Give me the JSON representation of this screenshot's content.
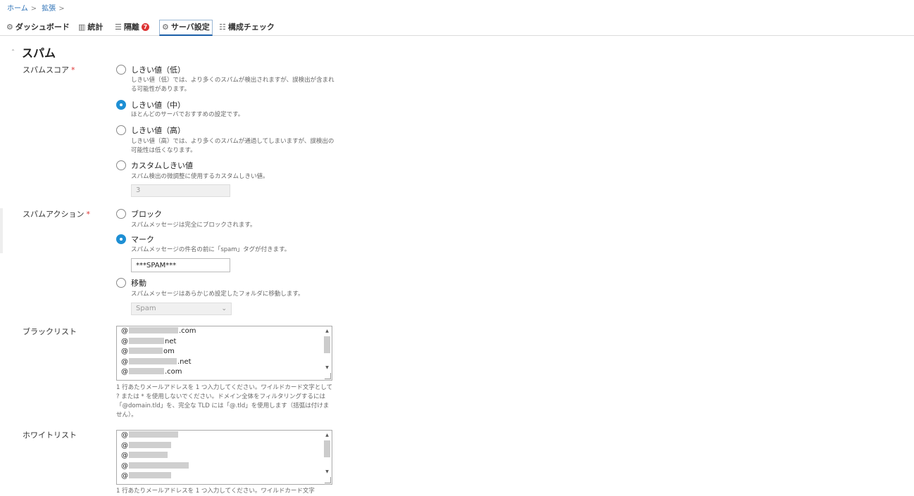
{
  "breadcrumb": {
    "home": "ホーム",
    "sep": ">",
    "extensions": "拡張",
    "sep2": ">"
  },
  "tabs": [
    {
      "icon": "⚙",
      "label": "ダッシュボード"
    },
    {
      "icon": "▥",
      "label": "統計"
    },
    {
      "icon": "☰",
      "label": "隔離",
      "badge": "7"
    },
    {
      "icon": "⚙",
      "label": "サーバ設定"
    },
    {
      "icon": "☷",
      "label": "構成チェック"
    }
  ],
  "section": {
    "chevron": "ˆ",
    "title": "スパム"
  },
  "spam_score": {
    "label": "スパムスコア",
    "required": "*",
    "options": [
      {
        "label": "しきい値（低）",
        "hint": "しきい値（低）では、より多くのスパムが検出されますが、誤検出が含まれる可能性があります。",
        "checked": false
      },
      {
        "label": "しきい値（中）",
        "hint": "ほとんどのサーバでおすすめの設定です。",
        "checked": true
      },
      {
        "label": "しきい値（高）",
        "hint": "しきい値（高）では、より多くのスパムが通過してしまいますが、誤検出の可能性は低くなります。",
        "checked": false
      },
      {
        "label": "カスタムしきい値",
        "hint": "スパム検出の微調整に使用するカスタムしきい値。",
        "checked": false
      }
    ],
    "custom_value": "3"
  },
  "spam_action": {
    "label": "スパムアクション",
    "required": "*",
    "options": [
      {
        "label": "ブロック",
        "hint": "スパムメッセージは完全にブロックされます。",
        "checked": false
      },
      {
        "label": "マーク",
        "hint": "スパムメッセージの件名の前に「spam」タグが付きます。",
        "checked": true
      },
      {
        "label": "移動",
        "hint": "スパムメッセージはあらかじめ設定したフォルダに移動します。",
        "checked": false
      }
    ],
    "mark_tag": "***SPAM***",
    "folder": "Spam"
  },
  "blacklist": {
    "label": "ブラックリスト",
    "items": [
      ".com",
      "net",
      "om",
      ".net",
      ".com"
    ],
    "hint": "1 行あたりメールアドレスを 1 つ入力してください。ワイルドカード文字として ? または * を使用しないでください。ドメイン全体をフィルタリングするには「@domain.tld」を、完全な TLD には「@.tld」を使用します（括弧は付けません）。"
  },
  "whitelist": {
    "label": "ホワイトリスト",
    "items": [
      "",
      "",
      "",
      "",
      ""
    ],
    "hint": "1 行あたりメールアドレスを 1 つ入力してください。ワイルドカード文字"
  },
  "at_sign": "@"
}
